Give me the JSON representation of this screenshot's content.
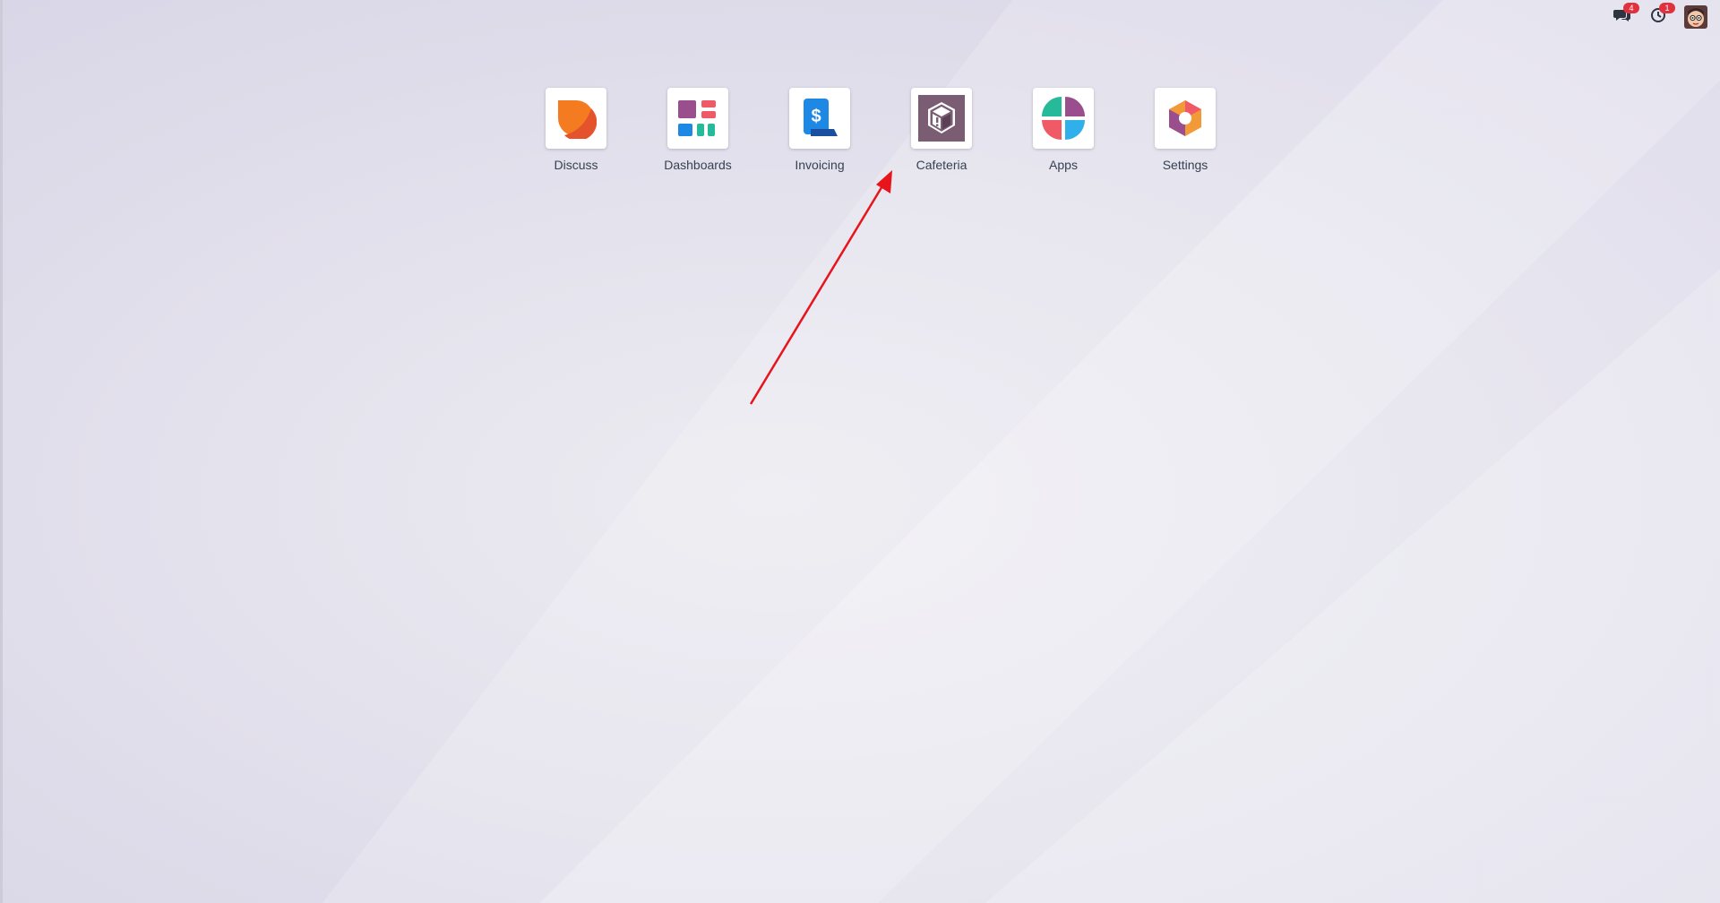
{
  "systray": {
    "messages_badge": "4",
    "activities_badge": "1",
    "icons": [
      "chat-icon",
      "clock-icon",
      "user-avatar"
    ]
  },
  "apps": [
    {
      "label": "Discuss",
      "icon": "discuss-icon"
    },
    {
      "label": "Dashboards",
      "icon": "dashboards-icon"
    },
    {
      "label": "Invoicing",
      "icon": "invoicing-icon"
    },
    {
      "label": "Cafeteria",
      "icon": "cafeteria-icon"
    },
    {
      "label": "Apps",
      "icon": "apps-icon"
    },
    {
      "label": "Settings",
      "icon": "settings-icon"
    }
  ],
  "colors": {
    "badge": "#e0313f",
    "annotation_arrow": "#e8141c",
    "discuss_orange": "#f47b20",
    "dashboards_purple": "#9b4e8e",
    "invoicing_blue": "#1e88e5",
    "cafeteria_purple": "#7a5c73",
    "settings_orange": "#f29a38"
  }
}
